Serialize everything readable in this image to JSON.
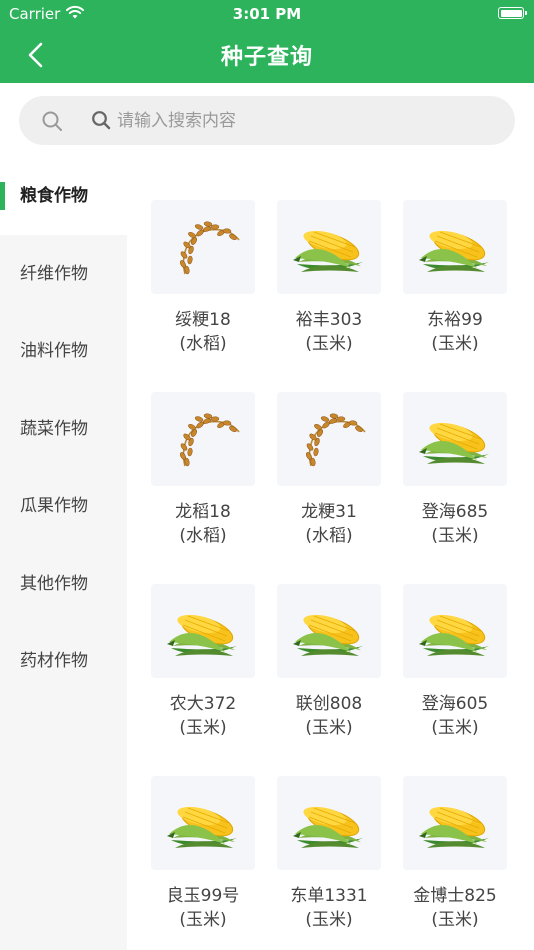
{
  "status_bar": {
    "carrier": "Carrier",
    "time": "3:01 PM"
  },
  "nav": {
    "title": "种子查询"
  },
  "search": {
    "placeholder": "请输入搜索内容"
  },
  "categories": [
    {
      "label": "粮食作物",
      "active": true
    },
    {
      "label": "纤维作物",
      "active": false
    },
    {
      "label": "油料作物",
      "active": false
    },
    {
      "label": "蔬菜作物",
      "active": false
    },
    {
      "label": "瓜果作物",
      "active": false
    },
    {
      "label": "其他作物",
      "active": false
    },
    {
      "label": "药材作物",
      "active": false
    }
  ],
  "varieties": [
    {
      "name": "绥粳18",
      "type": "(水稻)",
      "icon": "rice-icon"
    },
    {
      "name": "裕丰303",
      "type": "(玉米)",
      "icon": "corn-icon"
    },
    {
      "name": "东裕99",
      "type": "(玉米)",
      "icon": "corn-icon"
    },
    {
      "name": "龙稻18",
      "type": "(水稻)",
      "icon": "rice-icon"
    },
    {
      "name": "龙粳31",
      "type": "(水稻)",
      "icon": "rice-icon"
    },
    {
      "name": "登海685",
      "type": "(玉米)",
      "icon": "corn-icon"
    },
    {
      "name": "农大372",
      "type": "(玉米)",
      "icon": "corn-icon"
    },
    {
      "name": "联创808",
      "type": "(玉米)",
      "icon": "corn-icon"
    },
    {
      "name": "登海605",
      "type": "(玉米)",
      "icon": "corn-icon"
    },
    {
      "name": "良玉99号",
      "type": "(玉米)",
      "icon": "corn-icon"
    },
    {
      "name": "东单1331",
      "type": "(玉米)",
      "icon": "corn-icon"
    },
    {
      "name": "金博士825",
      "type": "(玉米)",
      "icon": "corn-icon"
    }
  ],
  "colors": {
    "accent": "#2db35c",
    "sidebar_bg": "#f6f6f6",
    "card_bg": "#f5f6fa"
  }
}
